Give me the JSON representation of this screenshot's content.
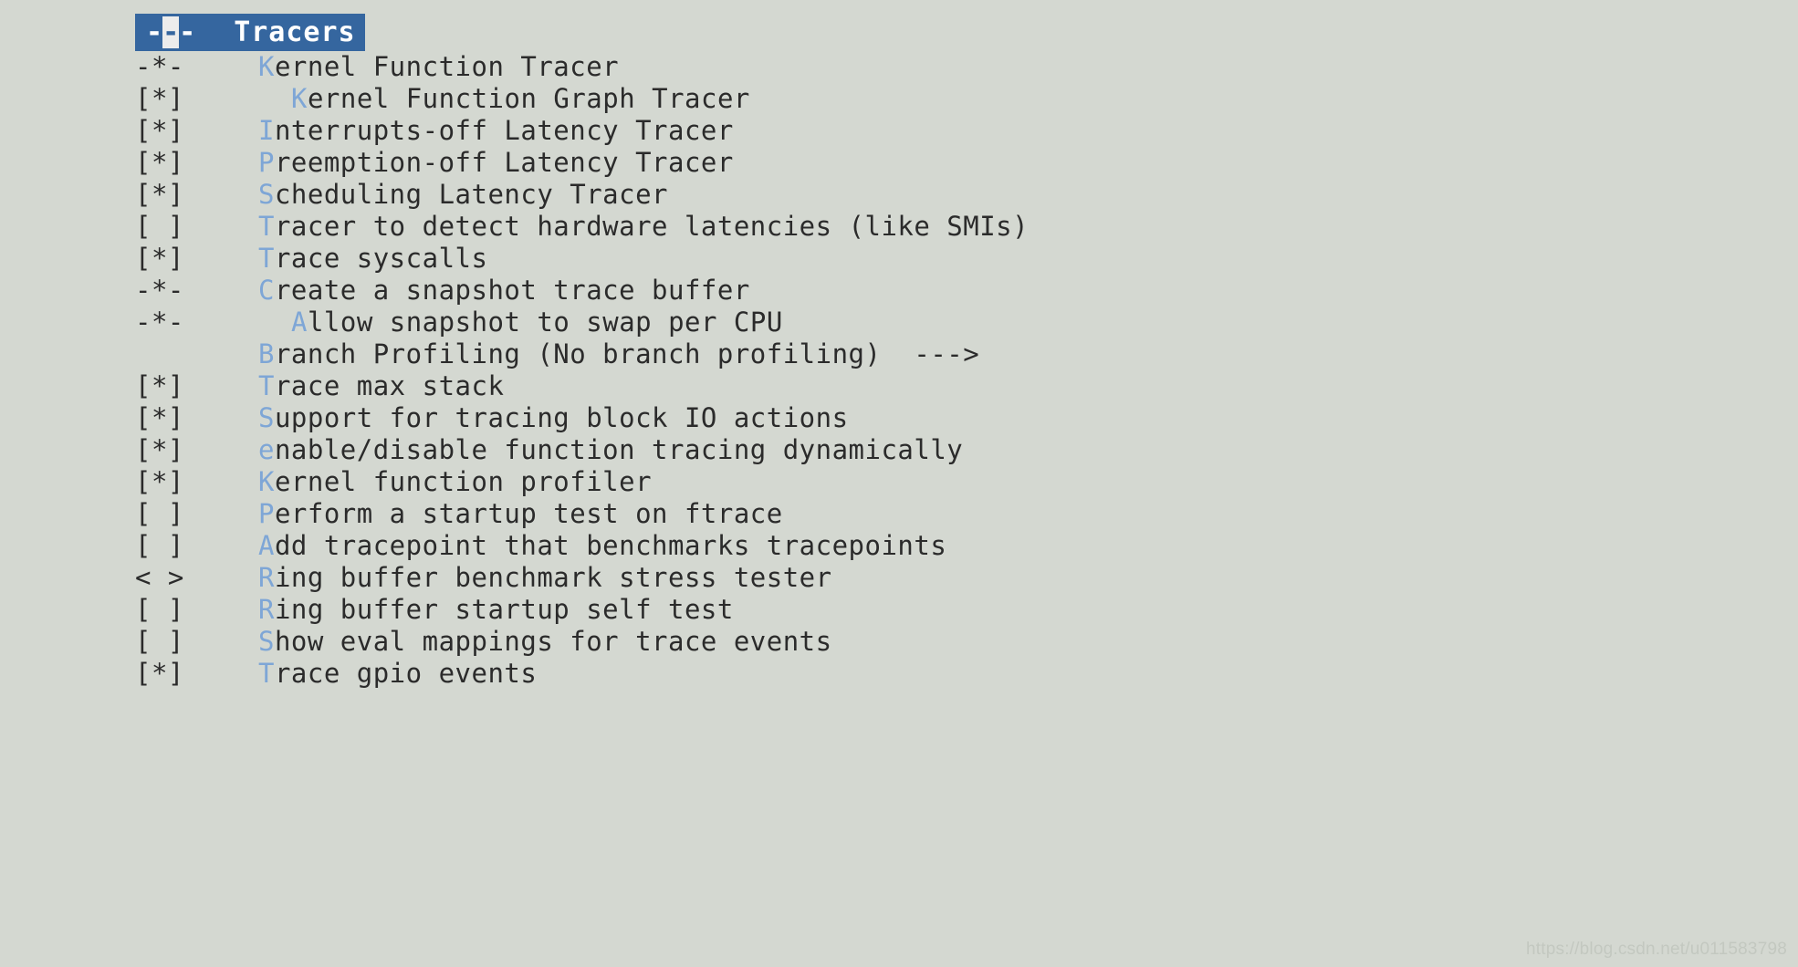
{
  "window": {
    "title": "Tracers",
    "title_prefix_dashes": "---",
    "cursor_char": "-",
    "accent_color": "#35669f",
    "cursor_color": "#ececec",
    "background_color": "#d4d8d1",
    "text_color": "#2b2b2b",
    "hotkey_color": "#7ea6d6"
  },
  "options": [
    {
      "marker": "-*-",
      "hotkey": "K",
      "rest": "ernel Function Tracer",
      "indent": false
    },
    {
      "marker": "[*]",
      "hotkey": "K",
      "rest": "ernel Function Graph Tracer",
      "indent": true
    },
    {
      "marker": "[*]",
      "hotkey": "I",
      "rest": "nterrupts-off Latency Tracer",
      "indent": false
    },
    {
      "marker": "[*]",
      "hotkey": "P",
      "rest": "reemption-off Latency Tracer",
      "indent": false
    },
    {
      "marker": "[*]",
      "hotkey": "S",
      "rest": "cheduling Latency Tracer",
      "indent": false
    },
    {
      "marker": "[ ]",
      "hotkey": "T",
      "rest": "racer to detect hardware latencies (like SMIs)",
      "indent": false
    },
    {
      "marker": "[*]",
      "hotkey": "T",
      "rest": "race syscalls",
      "indent": false
    },
    {
      "marker": "-*-",
      "hotkey": "C",
      "rest": "reate a snapshot trace buffer",
      "indent": false
    },
    {
      "marker": "-*-",
      "hotkey": "A",
      "rest": "llow snapshot to swap per CPU",
      "indent": true
    },
    {
      "marker": "",
      "hotkey": "B",
      "rest": "ranch Profiling (No branch profiling)  --->",
      "indent": false
    },
    {
      "marker": "[*]",
      "hotkey": "T",
      "rest": "race max stack",
      "indent": false
    },
    {
      "marker": "[*]",
      "hotkey": "S",
      "rest": "upport for tracing block IO actions",
      "indent": false
    },
    {
      "marker": "[*]",
      "hotkey": "e",
      "rest": "nable/disable function tracing dynamically",
      "indent": false
    },
    {
      "marker": "[*]",
      "hotkey": "K",
      "rest": "ernel function profiler",
      "indent": false
    },
    {
      "marker": "[ ]",
      "hotkey": "P",
      "rest": "erform a startup test on ftrace",
      "indent": false
    },
    {
      "marker": "[ ]",
      "hotkey": "A",
      "rest": "dd tracepoint that benchmarks tracepoints",
      "indent": false
    },
    {
      "marker": "< >",
      "hotkey": "R",
      "rest": "ing buffer benchmark stress tester",
      "indent": false
    },
    {
      "marker": "[ ]",
      "hotkey": "R",
      "rest": "ing buffer startup self test",
      "indent": false
    },
    {
      "marker": "[ ]",
      "hotkey": "S",
      "rest": "how eval mappings for trace events",
      "indent": false
    },
    {
      "marker": "[*]",
      "hotkey": "T",
      "rest": "race gpio events",
      "indent": false
    }
  ],
  "watermark": {
    "text": "https://blog.csdn.net/u011583798"
  }
}
